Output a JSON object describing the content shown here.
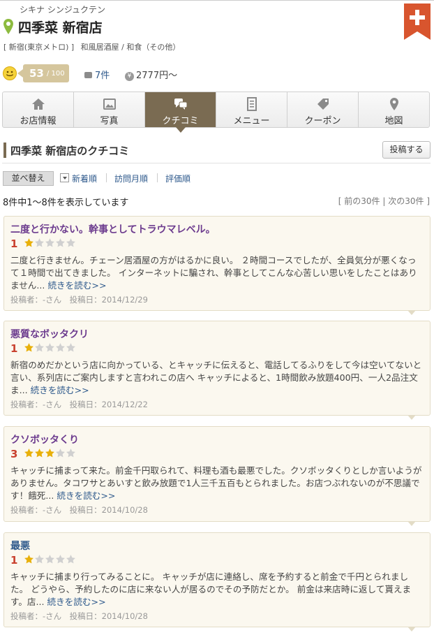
{
  "shop": {
    "kana": "シキナ シンジュクテン",
    "name": "四季菜 新宿店",
    "meta_station": "[ 新宿(東京メトロ) ]",
    "meta_genre": "和風居酒屋 / 和食（その他）"
  },
  "score": {
    "value": "53",
    "max": "/ 100",
    "reviews": "7件",
    "price": "2777円～"
  },
  "tabs": [
    {
      "label": "お店情報",
      "icon": "home-icon"
    },
    {
      "label": "写真",
      "icon": "photo-icon"
    },
    {
      "label": "クチコミ",
      "icon": "chat-icon",
      "active": true
    },
    {
      "label": "メニュー",
      "icon": "menu-icon"
    },
    {
      "label": "クーポン",
      "icon": "coupon-icon"
    },
    {
      "label": "地図",
      "icon": "map-pin-icon"
    }
  ],
  "section": {
    "title": "四季菜 新宿店のクチコミ",
    "post_button": "投稿する"
  },
  "sort": {
    "button": "並べ替え",
    "options": [
      "新着順",
      "訪問月順",
      "評価順"
    ]
  },
  "listing": {
    "count": "8件中1～8件を表示しています",
    "pager_open": "[ ",
    "prev": "前の30件",
    "sep": " | ",
    "next": "次の30件",
    "pager_close": " ]"
  },
  "reviews": [
    {
      "title": "二度と行かない。幹事としてトラウマレベル。",
      "rating": "1",
      "stars": 1,
      "body": "二度と行きません。チェーン居酒屋の方がはるかに良い。 ２時間コースでしたが、全員気分が悪くなって１時間で出てきました。 インターネットに騙され、幹事としてこんな心苦しい思いをしたことはありません...",
      "more": "続きを読む>>",
      "footer": "投稿者：-さん　投稿日：2014/12/29"
    },
    {
      "title": "悪質なボッタクリ",
      "rating": "1",
      "stars": 1,
      "body": "新宿のめだかという店に向かっている、とキャッチに伝えると、電話してるふりをして今は空いてないと言い、系列店にご案内しますと言われこの店へ キャッチによると、1時間飲み放題400円、一人2品注文 ま...",
      "more": "続きを読む>>",
      "footer": "投稿者：-さん　投稿日：2014/12/22"
    },
    {
      "title": "クソボッタくり",
      "rating": "3",
      "stars": 3,
      "body": "キャッチに捕まって来た。前金千円取られて、料理も酒も最悪でした。クソボッタくりとしか言いようがありません。タコワサとあいすと飲み放題で1人三千五百もとられました。お店つぶれないのが不思議です！餓死...",
      "more": "続きを読む>>",
      "footer": "投稿者：-さん　投稿日：2014/10/28"
    },
    {
      "title": "最悪",
      "rating": "1",
      "stars": 1,
      "body": "キャッチに捕まり行ってみることに。 キャッチが店に連絡し、席を予約すると前金で千円とられました。 どうやら、予約したのに店に来ない人が居るのでその予防だとか。 前金は来店時に返して貰えます。店...",
      "more": "続きを読む>>",
      "footer": "投稿者：-さん　投稿日：2014/10/28"
    }
  ],
  "colors": {
    "accent": "#7a6b52",
    "score_badge": "#d5c69d",
    "title_purple": "#6c3b8e",
    "link_blue": "#2f5a8c",
    "rating_red": "#c9412f",
    "card_bg": "#fbf8ef",
    "star_gold": "#e8b00a"
  }
}
